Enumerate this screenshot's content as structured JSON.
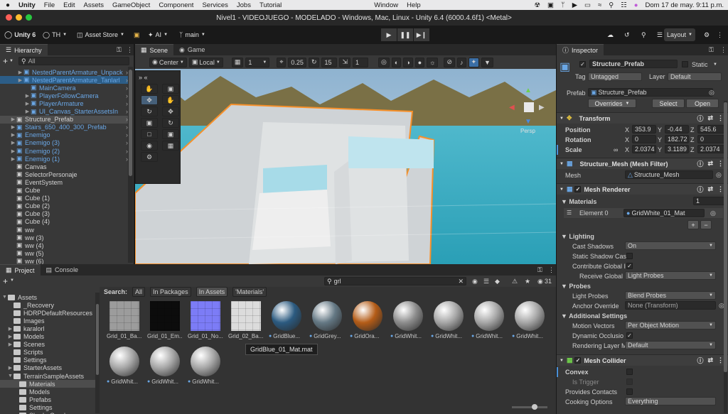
{
  "menubar": {
    "app": "Unity",
    "items": [
      "File",
      "Edit",
      "Assets",
      "GameObject",
      "Component",
      "Services",
      "Jobs",
      "Tutorial",
      "Window",
      "Help"
    ],
    "datetime": "Dom 17 de may.  9:11 p.m."
  },
  "titlebar": {
    "title": "Nivel1 - VIDEOJUEGO - MODELADO - Windows, Mac, Linux - Unity 6.4 (6000.4.6f1) <Metal>"
  },
  "toolbar": {
    "unity_label": "Unity 6",
    "account": "TH",
    "asset_store": "Asset Store",
    "ai": "AI",
    "branch": "main",
    "layout": "Layout"
  },
  "hierarchy": {
    "tab": "Hierarchy",
    "search_placeholder": "All",
    "rows": [
      {
        "label": "NestedParentArmature_Unpack",
        "blue": true
      },
      {
        "label": "NestedParentArmature_Tanlarl",
        "blue": true
      },
      {
        "label": "MainCamera",
        "blue": true
      },
      {
        "label": "PlayerFollowCamera",
        "blue": true
      },
      {
        "label": "PlayerArmature",
        "blue": true
      },
      {
        "label": "UI_Canvas_StarterAssetsIn",
        "blue": true
      },
      {
        "label": "Structure_Prefab",
        "blue": false
      },
      {
        "label": "Stairs_650_400_300_Prefab",
        "blue": true
      },
      {
        "label": "Enemigo",
        "blue": true
      },
      {
        "label": "Enemigo (3)",
        "blue": true
      },
      {
        "label": "Enemigo (2)",
        "blue": true
      },
      {
        "label": "Enemigo (1)",
        "blue": true
      },
      {
        "label": "Canvas",
        "blue": false
      },
      {
        "label": "SelectorPersonaje",
        "blue": false
      },
      {
        "label": "EventSystem",
        "blue": false
      },
      {
        "label": "Cube",
        "blue": false
      },
      {
        "label": "Cube (1)",
        "blue": false
      },
      {
        "label": "Cube (2)",
        "blue": false
      },
      {
        "label": "Cube (3)",
        "blue": false
      },
      {
        "label": "Cube (4)",
        "blue": false
      },
      {
        "label": "ww",
        "blue": false
      },
      {
        "label": "ww (3)",
        "blue": false
      },
      {
        "label": "ww (4)",
        "blue": false
      },
      {
        "label": "ww (5)",
        "blue": false
      },
      {
        "label": "ww (6)",
        "blue": false
      }
    ]
  },
  "scene": {
    "tabs": [
      "Scene",
      "Game"
    ],
    "pivot": "Center",
    "space": "Local",
    "grid_size": "1",
    "snap_value": "0.25",
    "rot_snap": "15",
    "scale_snap": "1",
    "gizmo_label": "Persp"
  },
  "project": {
    "tabs": [
      "Project",
      "Console"
    ],
    "search_value": "grl",
    "count": "31",
    "search_label": "Search:",
    "filters": [
      "All",
      "In Packages",
      "In Assets",
      "'Materials'"
    ],
    "folders": [
      {
        "label": "Assets",
        "indent": 0
      },
      {
        "label": "_Recovery",
        "indent": 1
      },
      {
        "label": "HDRPDefaultResources",
        "indent": 1
      },
      {
        "label": "Images",
        "indent": 1
      },
      {
        "label": "karalorl",
        "indent": 1
      },
      {
        "label": "Models",
        "indent": 1
      },
      {
        "label": "Scenes",
        "indent": 1
      },
      {
        "label": "Scripts",
        "indent": 1
      },
      {
        "label": "Settings",
        "indent": 1
      },
      {
        "label": "StarterAssets",
        "indent": 1
      },
      {
        "label": "TerrainSampleAssets",
        "indent": 1
      },
      {
        "label": "Materials",
        "indent": 2
      },
      {
        "label": "Models",
        "indent": 2
      },
      {
        "label": "Prefabs",
        "indent": 2
      },
      {
        "label": "Settings",
        "indent": 2
      },
      {
        "label": "ShaderGraphs",
        "indent": 2
      }
    ],
    "assets": [
      {
        "label": "Grid_01_Ba...",
        "kind": "flat",
        "color": "#9c9c9c"
      },
      {
        "label": "Grid_01_Em...",
        "kind": "flat",
        "color": "#0c0c0c"
      },
      {
        "label": "Grid_01_No...",
        "kind": "flat",
        "color": "#7c7cf6"
      },
      {
        "label": "Grid_02_Ba...",
        "kind": "flat",
        "color": "#dcdcdc"
      },
      {
        "label": "GridBlue...",
        "kind": "sphere",
        "color": "#2b5a80"
      },
      {
        "label": "GridGrey...",
        "kind": "sphere",
        "color": "#647884"
      },
      {
        "label": "GridOra...",
        "kind": "sphere",
        "color": "#b45c17"
      },
      {
        "label": "GridWhit...",
        "kind": "sphere",
        "color": "#8c8c8c"
      },
      {
        "label": "GridWhit...",
        "kind": "sphere",
        "color": "#a6a6a6"
      },
      {
        "label": "GridWhit...",
        "kind": "sphere",
        "color": "#a6a6a6"
      },
      {
        "label": "GridWhit...",
        "kind": "sphere",
        "color": "#a6a6a6"
      },
      {
        "label": "GridWhit...",
        "kind": "sphere",
        "color": "#a6a6a6"
      },
      {
        "label": "GridWhit...",
        "kind": "sphere",
        "color": "#a6a6a6"
      },
      {
        "label": "GridWhit...",
        "kind": "sphere",
        "color": "#a6a6a6"
      }
    ],
    "tooltip": "GridBlue_01_Mat.mat"
  },
  "inspector": {
    "tab": "Inspector",
    "object_name": "Structure_Prefab",
    "static_label": "Static",
    "tag_label": "Tag",
    "tag_value": "Untagged",
    "layer_label": "Layer",
    "layer_value": "Default",
    "prefab_label": "Prefab",
    "prefab_value": "Structure_Prefab",
    "overrides": "Overrides",
    "select": "Select",
    "open": "Open",
    "transform": {
      "title": "Transform",
      "position_label": "Position",
      "position": [
        "353.9",
        "-0.44",
        "545.6"
      ],
      "rotation_label": "Rotation",
      "rotation": [
        "0",
        "182.72",
        "0"
      ],
      "scale_label": "Scale",
      "scale": [
        "2.0374",
        "3.1189",
        "2.0374"
      ]
    },
    "mesh_filter": {
      "title": "Structure_Mesh (Mesh Filter)",
      "mesh_label": "Mesh",
      "mesh_value": "Structure_Mesh"
    },
    "mesh_renderer": {
      "title": "Mesh Renderer",
      "materials_label": "Materials",
      "materials_count": "1",
      "element_label": "Element 0",
      "element_value": "GridWhite_01_Mat",
      "lighting_label": "Lighting",
      "cast_shadows_label": "Cast Shadows",
      "cast_shadows": "On",
      "static_shadow_label": "Static Shadow Cas",
      "contribute_gi_label": "Contribute Global I",
      "receive_gi_label": "Receive Global I",
      "receive_gi": "Light Probes",
      "probes_label": "Probes",
      "light_probes_label": "Light Probes",
      "light_probes": "Blend Probes",
      "anchor_label": "Anchor Override",
      "anchor": "None (Transform)",
      "additional_label": "Additional Settings",
      "motion_label": "Motion Vectors",
      "motion": "Per Object Motion",
      "dynamic_occ_label": "Dynamic Occlusio",
      "rendering_layer_label": "Rendering Layer M",
      "rendering_layer": "Default"
    },
    "mesh_collider": {
      "title": "Mesh Collider",
      "convex_label": "Convex",
      "trigger_label": "Is Trigger",
      "contacts_label": "Provides Contacts",
      "cooking_label": "Cooking Options",
      "cooking": "Everything"
    }
  },
  "colors": {
    "accent": "#2c5d87",
    "selection_outline": "#f7902a",
    "panel": "#383838",
    "prefab_blue": "#6aa7e6"
  }
}
